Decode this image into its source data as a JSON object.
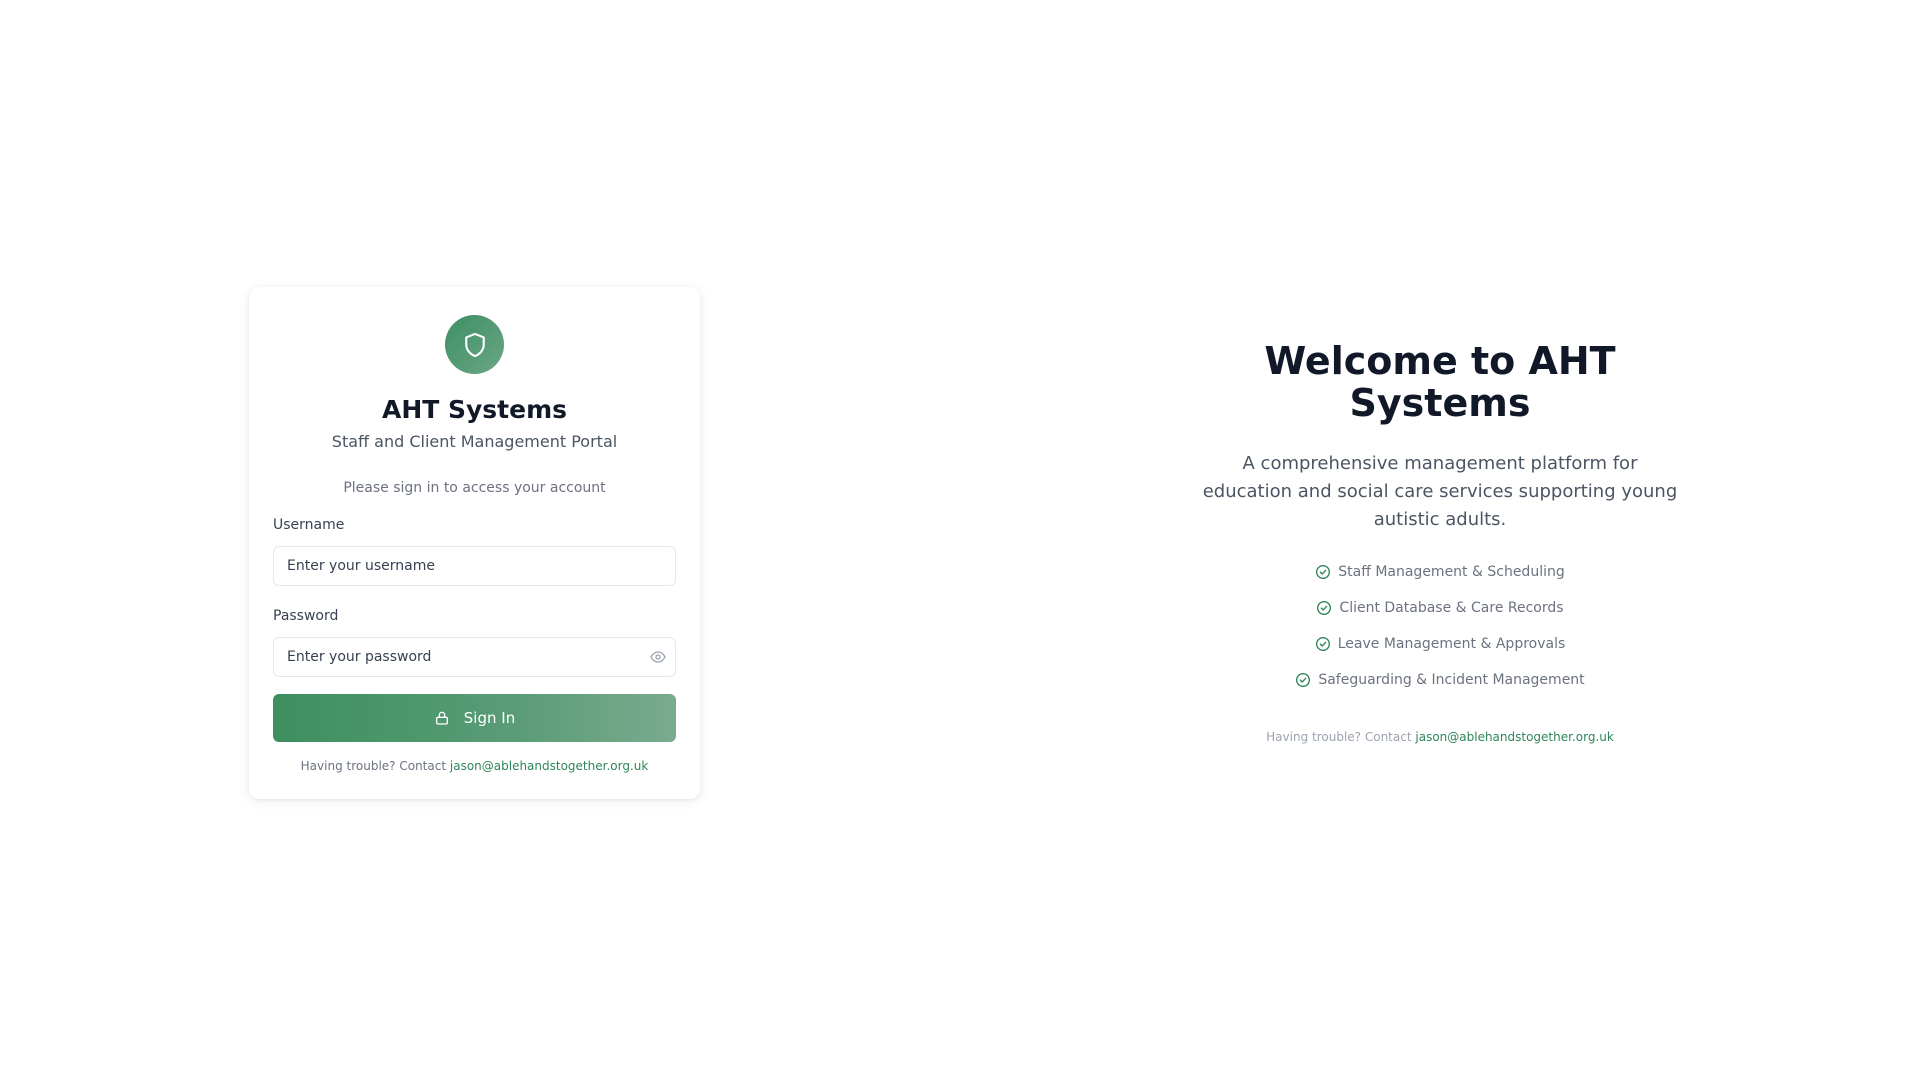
{
  "login_card": {
    "logo_icon": "shield-icon",
    "title": "AHT Systems",
    "subtitle": "Staff and Client Management Portal",
    "prompt": "Please sign in to access your account",
    "username": {
      "label": "Username",
      "placeholder": "Enter your username",
      "value": ""
    },
    "password": {
      "label": "Password",
      "placeholder": "Enter your password",
      "value": "",
      "toggle_icon": "eye-icon"
    },
    "signin_button": {
      "label": "Sign In",
      "icon": "lock-icon"
    },
    "footer": {
      "text": "Having trouble? Contact",
      "email": "jason@ablehandstogether.org.uk"
    }
  },
  "welcome": {
    "title": "Welcome to AHT Systems",
    "description": "A comprehensive management platform for education and social care services supporting young autistic adults.",
    "features": [
      {
        "icon": "check-circle-icon",
        "label": "Staff Management & Scheduling"
      },
      {
        "icon": "check-circle-icon",
        "label": "Client Database & Care Records"
      },
      {
        "icon": "check-circle-icon",
        "label": "Leave Management & Approvals"
      },
      {
        "icon": "check-circle-icon",
        "label": "Safeguarding & Incident Management"
      }
    ],
    "footer": {
      "text": "Having trouble? Contact",
      "email": "jason@ablehandstogether.org.uk"
    }
  },
  "colors": {
    "brand_green": "#3d8f63",
    "link_green": "#2f855a",
    "title_dark": "#111827"
  }
}
